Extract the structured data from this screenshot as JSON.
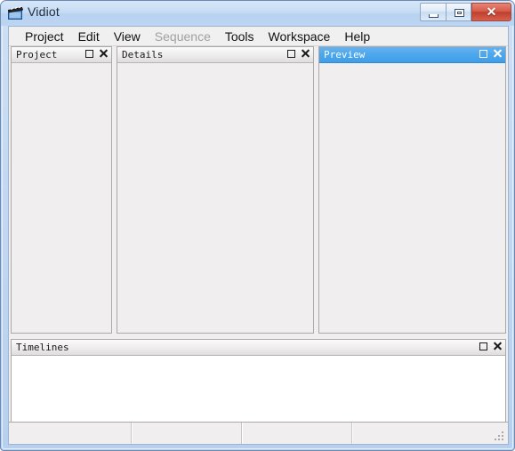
{
  "window": {
    "title": "Vidiot",
    "icon": "clapperboard-icon",
    "caption_buttons": [
      {
        "name": "minimize",
        "label": "—"
      },
      {
        "name": "maximize",
        "label": "□"
      },
      {
        "name": "close",
        "label": "✕"
      }
    ]
  },
  "menubar": {
    "items": [
      {
        "label": "Project",
        "disabled": false
      },
      {
        "label": "Edit",
        "disabled": false
      },
      {
        "label": "View",
        "disabled": false
      },
      {
        "label": "Sequence",
        "disabled": true
      },
      {
        "label": "Tools",
        "disabled": false
      },
      {
        "label": "Workspace",
        "disabled": false
      },
      {
        "label": "Help",
        "disabled": false
      }
    ]
  },
  "panes": {
    "project": {
      "title": "Project",
      "active": false,
      "content": ""
    },
    "details": {
      "title": "Details",
      "active": false,
      "content": ""
    },
    "preview": {
      "title": "Preview",
      "active": true,
      "content": ""
    },
    "timelines": {
      "title": "Timelines",
      "active": false,
      "content": ""
    }
  },
  "statusbar": {
    "fields": [
      "",
      "",
      "",
      ""
    ]
  },
  "colors": {
    "frame": "#b7d0ef",
    "titlebar_start": "#d8e7f8",
    "titlebar_end": "#bcd5f2",
    "client_bg": "#f0eeee",
    "pane_bg": "#f0eeee",
    "pane_header_bg": "#eeecec",
    "pane_header_active_bg": "#4da7ec",
    "pane_border": "#a9a9a9",
    "timeline_bg": "#ffffff",
    "menu_bg": "#f0f0f0",
    "menu_text": "#111111",
    "menu_disabled_text": "#a0a0a0",
    "close_button": "#d55c4b"
  }
}
